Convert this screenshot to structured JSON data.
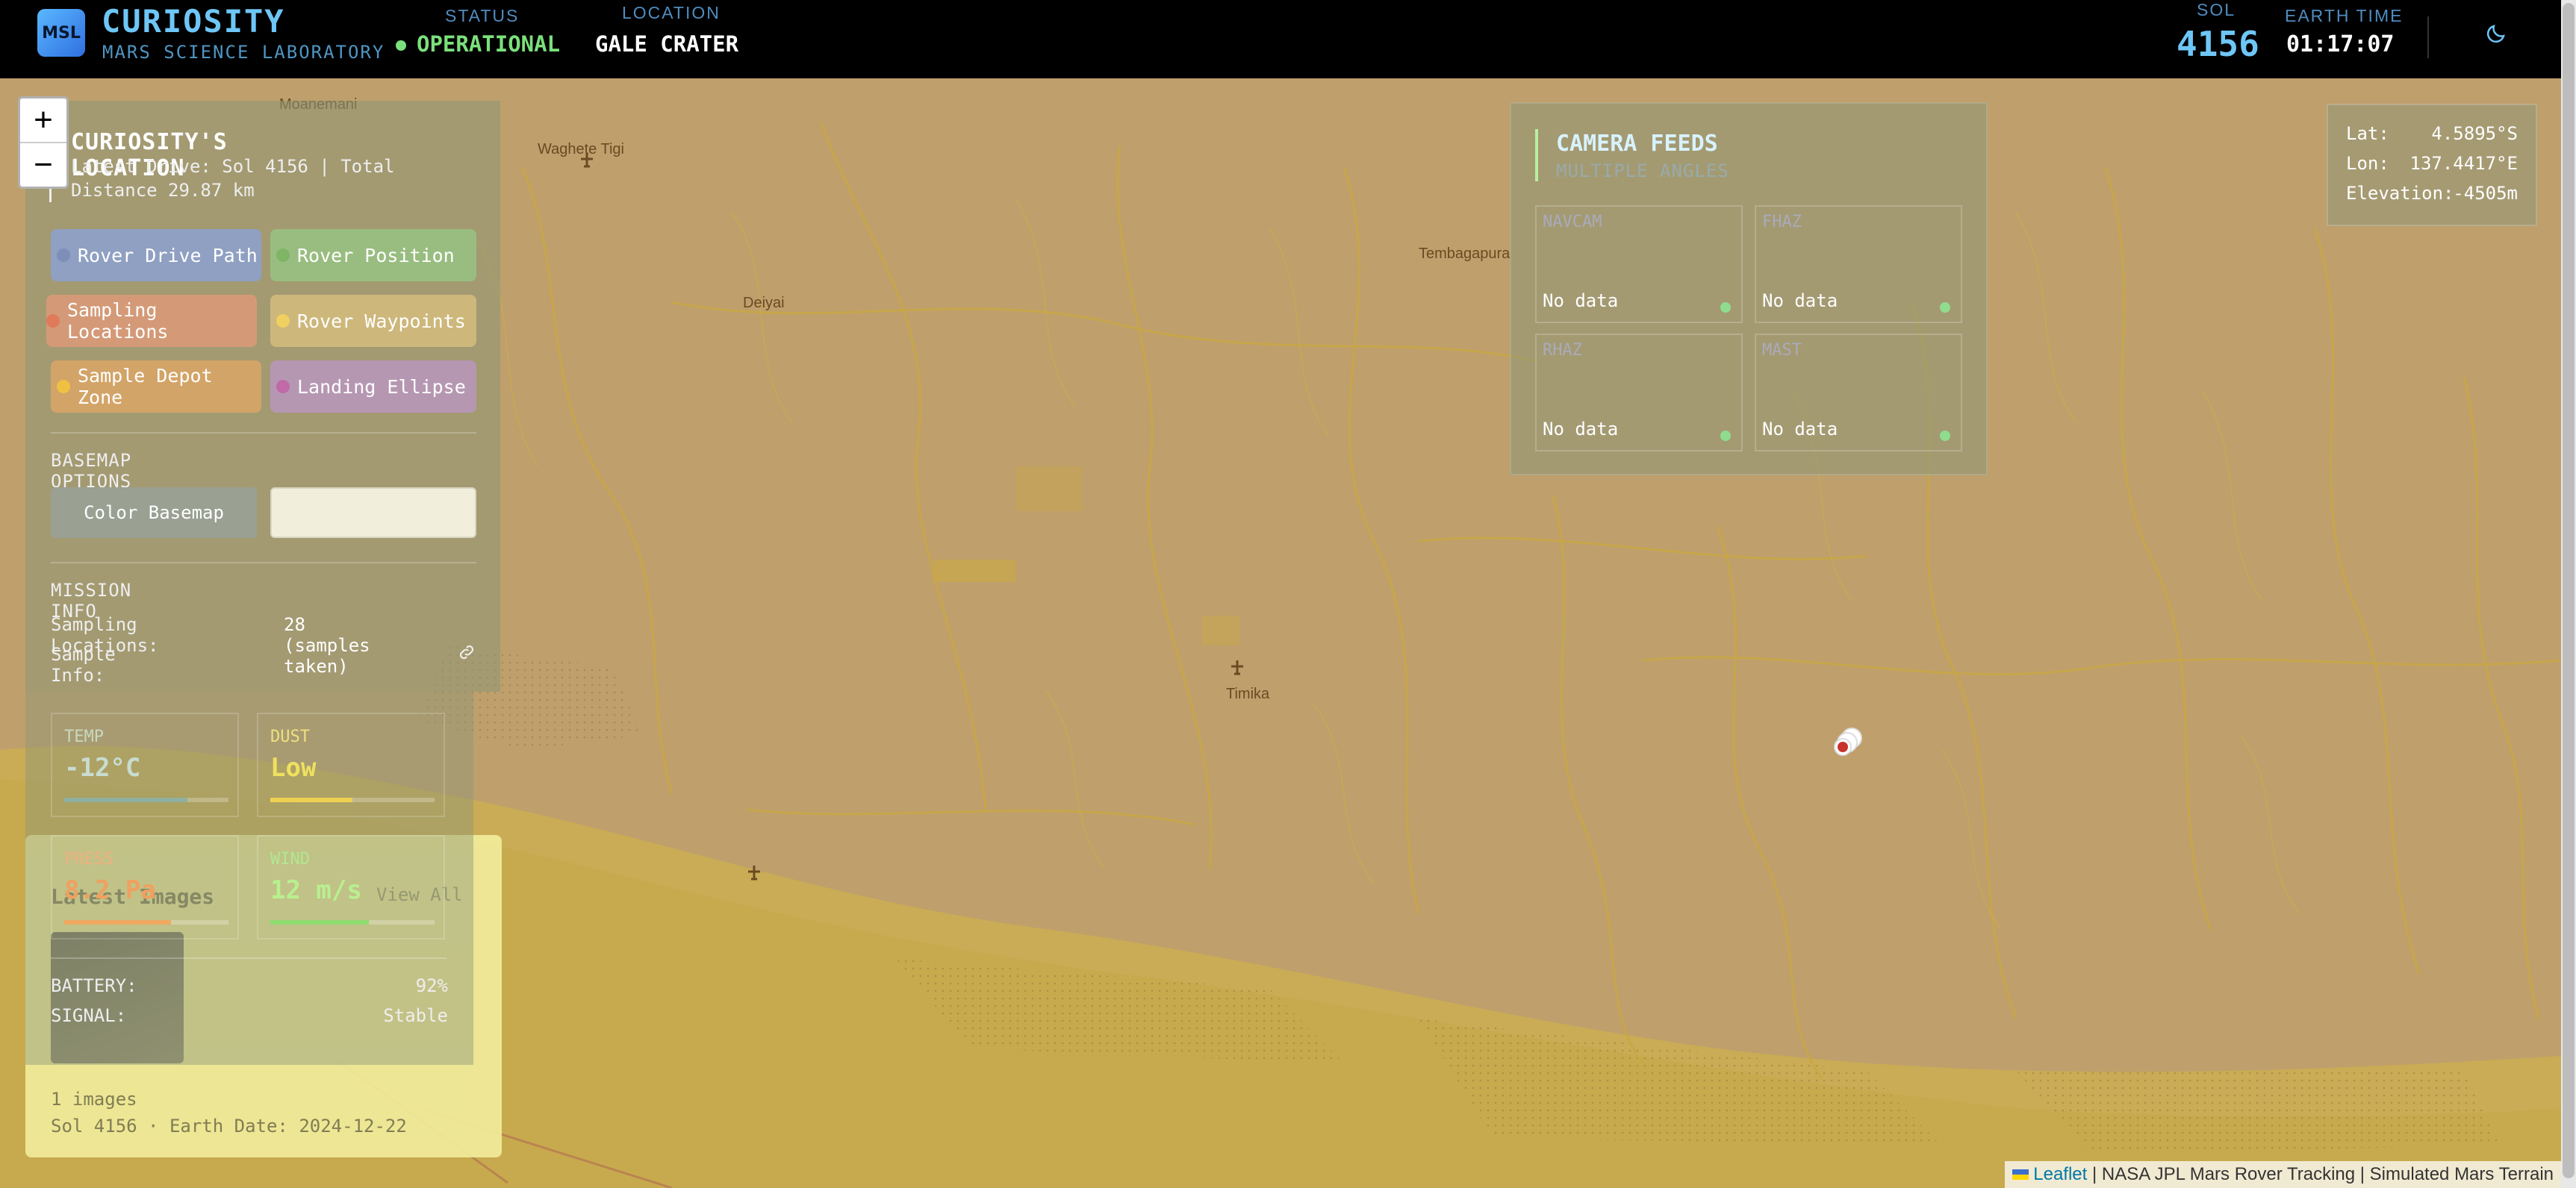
{
  "header": {
    "logo_text": "MSL",
    "title": "CURIOSITY",
    "subtitle": "MARS SCIENCE LABORATORY",
    "status_label": "STATUS",
    "status_value": "OPERATIONAL",
    "location_label": "LOCATION",
    "location_value": "GALE CRATER",
    "sol_label": "SOL",
    "sol_value": "4156",
    "earth_time_label": "EARTH TIME",
    "earth_time_value": "01:17:07",
    "theme_icon": "moon-icon"
  },
  "map": {
    "zoom_in": "+",
    "zoom_out": "−",
    "places": [
      "Moanemani",
      "Waghete Tigi",
      "Deiyai",
      "Tembagapura",
      "Timika"
    ]
  },
  "left_panel": {
    "title": "CURIOSITY'S LOCATION",
    "subtitle": "Latest Drive: Sol 4156 | Total Distance 29.87 km",
    "layers": [
      {
        "label": "Rover Drive Path",
        "dot": "#7d8fb8"
      },
      {
        "label": "Rover Position",
        "dot": "#7fb565"
      },
      {
        "label": "Sampling Locations",
        "dot": "#e07a5a"
      },
      {
        "label": "Rover Waypoints",
        "dot": "#f0d060"
      },
      {
        "label": "Sample Depot Zone",
        "dot": "#f0c040"
      },
      {
        "label": "Landing Ellipse",
        "dot": "#c06aa8"
      }
    ],
    "basemap_label": "BASEMAP OPTIONS",
    "basemap_color": "Color Basemap",
    "mission_label": "MISSION INFO",
    "sampling_key": "Sampling Locations:",
    "sampling_value": "28 (samples taken)",
    "sample_info_key": "Sample Info:"
  },
  "latest_images": {
    "title": "Latest Images",
    "view_all": "View All",
    "count": "1 images",
    "date": "Sol 4156 · Earth Date: 2024-12-22"
  },
  "weather": {
    "temp_label": "TEMP",
    "temp_value": "-12°C",
    "temp_level": 0.75,
    "temp_color": "#8fb0a0",
    "dust_label": "DUST",
    "dust_value": "Low",
    "dust_level": 0.5,
    "dust_color": "#f0d050",
    "press_label": "PRESS",
    "press_value": "8.2 Pa",
    "press_level": 0.65,
    "press_color": "#f0a860",
    "wind_label": "WIND",
    "wind_value": "12 m/s",
    "wind_level": 0.6,
    "wind_color": "#8fdc70",
    "battery_key": "BATTERY:",
    "battery_value": "92%",
    "signal_key": "SIGNAL:",
    "signal_value": "Stable"
  },
  "camera": {
    "title": "CAMERA FEEDS",
    "subtitle": "MULTIPLE ANGLES",
    "feeds": [
      {
        "name": "NAVCAM",
        "status": "No data"
      },
      {
        "name": "FHAZ",
        "status": "No data"
      },
      {
        "name": "RHAZ",
        "status": "No data"
      },
      {
        "name": "MAST",
        "status": "No data"
      }
    ]
  },
  "coords": {
    "lat_key": "Lat:",
    "lat_value": "4.5895°S",
    "lon_key": "Lon:",
    "lon_value": "137.4417°E",
    "elev_key": "Elevation:",
    "elev_value": "-4505m"
  },
  "attribution": {
    "leaflet": "Leaflet",
    "text": " | NASA JPL Mars Rover Tracking | Simulated Mars Terrain"
  }
}
